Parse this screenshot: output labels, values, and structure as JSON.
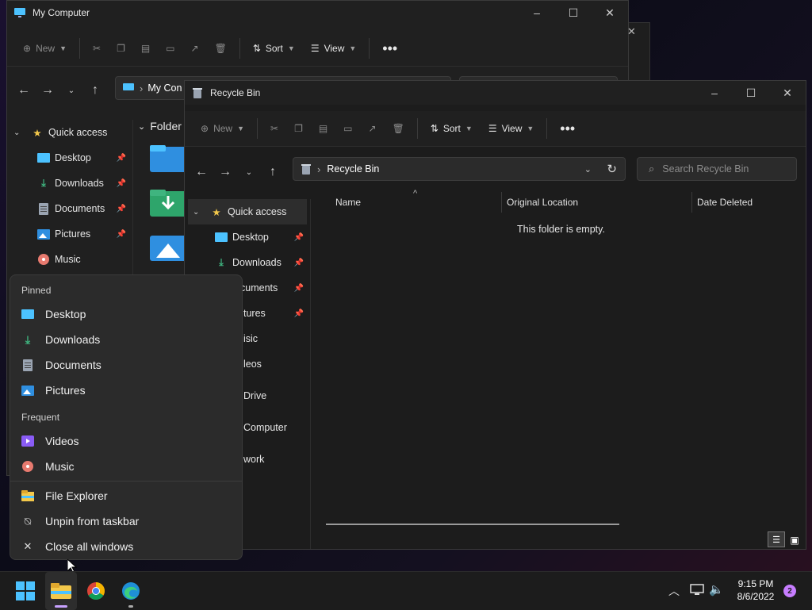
{
  "my_computer": {
    "title": "My Computer",
    "toolbar": {
      "new": "New",
      "sort": "Sort",
      "view": "View"
    },
    "address_text": "My Con",
    "section_folders": "Folder",
    "nav": [
      {
        "label": "Quick access",
        "icon": "star-icon"
      },
      {
        "label": "Desktop",
        "icon": "desktop-folder-icon",
        "pinned": true
      },
      {
        "label": "Downloads",
        "icon": "download-icon",
        "pinned": true
      },
      {
        "label": "Documents",
        "icon": "document-icon",
        "pinned": true
      },
      {
        "label": "Pictures",
        "icon": "pictures-icon",
        "pinned": true
      },
      {
        "label": "Music",
        "icon": "music-icon",
        "pinned": false
      }
    ]
  },
  "recycle_bin": {
    "title": "Recycle Bin",
    "toolbar": {
      "new": "New",
      "sort": "Sort",
      "view": "View"
    },
    "breadcrumb": "Recycle Bin",
    "search_placeholder": "Search Recycle Bin",
    "columns": [
      "Name",
      "Original Location",
      "Date Deleted"
    ],
    "empty_message": "This folder is empty.",
    "nav": [
      {
        "label": "Quick access",
        "icon": "star-icon"
      },
      {
        "label": "Desktop",
        "icon": "desktop-folder-icon",
        "pinned": true
      },
      {
        "label": "Downloads",
        "icon": "download-icon",
        "pinned": true
      },
      {
        "label": "cuments",
        "pinned": true
      },
      {
        "label": "tures",
        "pinned": true
      },
      {
        "label": "isic"
      },
      {
        "label": "leos"
      },
      {
        "label": "Drive"
      },
      {
        "label": "Computer"
      },
      {
        "label": "work"
      }
    ]
  },
  "jump_list": {
    "pinned_header": "Pinned",
    "pinned": [
      {
        "label": "Desktop",
        "icon": "desktop-folder-icon"
      },
      {
        "label": "Downloads",
        "icon": "download-icon"
      },
      {
        "label": "Documents",
        "icon": "document-icon"
      },
      {
        "label": "Pictures",
        "icon": "pictures-icon"
      }
    ],
    "frequent_header": "Frequent",
    "frequent": [
      {
        "label": "Videos",
        "icon": "videos-icon"
      },
      {
        "label": "Music",
        "icon": "music-icon"
      }
    ],
    "actions": [
      {
        "label": "File Explorer",
        "icon": "file-explorer-icon"
      },
      {
        "label": "Unpin from taskbar",
        "icon": "unpin-icon"
      },
      {
        "label": "Close all windows",
        "icon": "close-icon"
      }
    ]
  },
  "taskbar": {
    "time": "9:15 PM",
    "date": "8/6/2022",
    "notification_count": "2",
    "apps": [
      "start-icon",
      "file-explorer-icon",
      "chrome-icon",
      "edge-icon"
    ]
  },
  "colors": {
    "accent": "#4cc2ff",
    "folder": "#f3c84b",
    "download": "#3fb47f",
    "badge": "#c77dff"
  }
}
